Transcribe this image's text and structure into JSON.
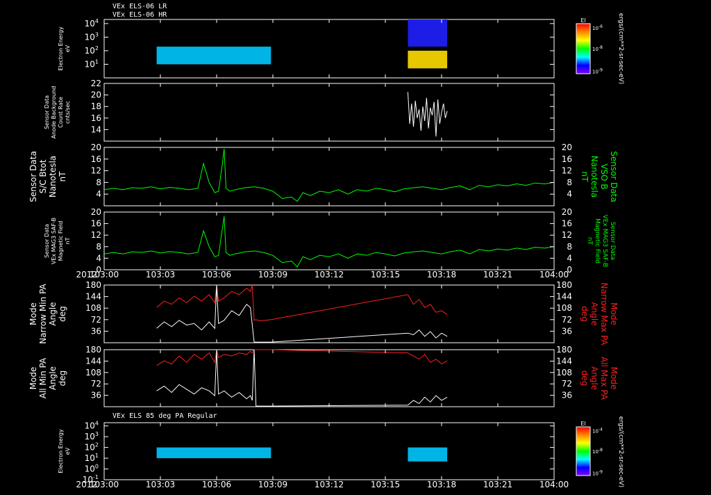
{
  "figure": {
    "header_lines": [
      "VEx ELS-06 LR",
      "VEx ELS-06 HR"
    ],
    "colorbar_unit": "ergs/(cm**2-sr-sec-eV)",
    "colorbar_title": "El",
    "time_axis_year": "2012",
    "time_ticks": [
      "103:00",
      "103:03",
      "103:06",
      "103:09",
      "103:12",
      "103:15",
      "103:18",
      "103:21",
      "104:00"
    ]
  },
  "chart_data": [
    {
      "id": "p1",
      "type": "heatmap",
      "ylabel": [
        "Electron Energy",
        "eV"
      ],
      "yscale": "log",
      "ylim": [
        1,
        20000
      ],
      "ytick_bases": [
        "10",
        "10",
        "10",
        "10"
      ],
      "ytick_exps": [
        "1",
        "2",
        "3",
        "4"
      ],
      "ytick_values": [
        10,
        100,
        1000,
        10000
      ],
      "colorbar": {
        "tick_bases": [
          "10",
          "10",
          "10"
        ],
        "tick_exps": [
          "-6",
          "-8",
          "-9"
        ],
        "colors": [
          "#ff0000",
          "#ff8800",
          "#ffff00",
          "#00ff00",
          "#00ffff",
          "#0000ff",
          "#8000ff"
        ]
      },
      "blocks": [
        {
          "x0": 2.8,
          "x1": 8.9,
          "ylo": 10,
          "yhi": 200,
          "color": "#00c8ff"
        },
        {
          "x0": 16.2,
          "x1": 18.3,
          "ylo": 5,
          "yhi": 100,
          "color": "#ffdd00"
        },
        {
          "x0": 16.2,
          "x1": 18.3,
          "ylo": 200,
          "yhi": 20000,
          "color": "#2020ff"
        }
      ]
    },
    {
      "id": "p2",
      "type": "line",
      "ylabel": [
        "Sensor Data",
        "Anode Background",
        "Count Rate",
        "cnts/sec"
      ],
      "ylim": [
        12,
        22
      ],
      "ytick_labels": [
        "14",
        "16",
        "18",
        "20",
        "22"
      ],
      "ytick_values": [
        14,
        16,
        18,
        20,
        22
      ],
      "series": [
        {
          "color": "#ffffff",
          "x": [
            16.2,
            16.3,
            16.4,
            16.5,
            16.6,
            16.7,
            16.8,
            16.9,
            17.0,
            17.1,
            17.2,
            17.3,
            17.4,
            17.5,
            17.6,
            17.7,
            17.8,
            17.9,
            18.0,
            18.1,
            18.2,
            18.3
          ],
          "y": [
            20.5,
            15.0,
            18.5,
            14.5,
            19.0,
            16.0,
            17.5,
            13.8,
            18.0,
            15.5,
            19.5,
            14.2,
            17.8,
            16.5,
            18.8,
            12.8,
            19.2,
            15.0,
            17.0,
            18.5,
            16.0,
            17.2
          ]
        }
      ]
    },
    {
      "id": "p3",
      "type": "line",
      "ylabel": [
        "Sensor Data",
        "S/C Btot",
        "Nanotesla",
        "nT"
      ],
      "ylabel_right": [
        "Sensor Data",
        "VSO B",
        "Nanotesla",
        "nT"
      ],
      "ylim": [
        0,
        20
      ],
      "ytick_labels": [
        "4",
        "8",
        "12",
        "16",
        "20"
      ],
      "ytick_values": [
        4,
        8,
        12,
        16,
        20
      ],
      "series": [
        {
          "color": "#00ff00",
          "x": [
            0.0,
            0.5,
            1.0,
            1.5,
            2.0,
            2.5,
            3.0,
            3.5,
            4.0,
            4.5,
            5.0,
            5.3,
            5.6,
            5.9,
            6.1,
            6.3,
            6.4,
            6.5,
            6.7,
            7.0,
            7.5,
            8.0,
            8.5,
            9.0,
            9.5,
            10.0,
            10.3,
            10.6,
            11.0,
            11.5,
            12.0,
            12.5,
            13.0,
            13.5,
            14.0,
            14.5,
            15.0,
            15.5,
            16.0,
            16.5,
            17.0,
            17.5,
            18.0,
            18.5,
            19.0,
            19.5,
            20.0,
            20.5,
            21.0,
            21.5,
            22.0,
            22.5,
            23.0,
            23.5,
            24.0
          ],
          "y": [
            5.5,
            6.0,
            5.5,
            6.2,
            6.0,
            6.5,
            5.8,
            6.3,
            6.0,
            5.5,
            6.0,
            14.5,
            8.0,
            4.5,
            5.0,
            14.0,
            19.5,
            6.0,
            5.0,
            5.5,
            6.2,
            6.5,
            6.0,
            5.0,
            2.5,
            3.0,
            1.5,
            4.5,
            3.5,
            5.0,
            4.5,
            5.5,
            4.0,
            5.5,
            5.0,
            6.0,
            5.5,
            4.8,
            5.8,
            6.2,
            6.5,
            6.0,
            5.5,
            6.3,
            6.8,
            5.5,
            7.0,
            6.5,
            7.2,
            6.8,
            7.5,
            7.0,
            7.8,
            7.5,
            8.0
          ]
        }
      ]
    },
    {
      "id": "p4",
      "type": "line",
      "ylabel": [
        "Sensor Data",
        "VEx MAG3 SAF-B",
        "Magnetic Field",
        "nT"
      ],
      "ylabel_right": [
        "Sensor Data",
        "VEx MAG3 SAF-B",
        "Magnetic Field",
        "nT"
      ],
      "ylim": [
        0,
        20
      ],
      "ytick_labels": [
        "0",
        "4",
        "8",
        "12",
        "16",
        "20"
      ],
      "ytick_values": [
        0,
        4,
        8,
        12,
        16,
        20
      ],
      "series": [
        {
          "color": "#00ff00",
          "x": [
            0.0,
            0.5,
            1.0,
            1.5,
            2.0,
            2.5,
            3.0,
            3.5,
            4.0,
            4.5,
            5.0,
            5.3,
            5.6,
            5.9,
            6.1,
            6.3,
            6.4,
            6.5,
            6.7,
            7.0,
            7.5,
            8.0,
            8.5,
            9.0,
            9.5,
            10.0,
            10.3,
            10.6,
            11.0,
            11.5,
            12.0,
            12.5,
            13.0,
            13.5,
            14.0,
            14.5,
            15.0,
            15.5,
            16.0,
            16.5,
            17.0,
            17.5,
            18.0,
            18.5,
            19.0,
            19.5,
            20.0,
            20.5,
            21.0,
            21.5,
            22.0,
            22.5,
            23.0,
            23.5,
            24.0
          ],
          "y": [
            5.5,
            6.0,
            5.5,
            6.2,
            6.0,
            6.5,
            5.8,
            6.3,
            6.0,
            5.5,
            6.0,
            13.5,
            8.0,
            4.5,
            5.0,
            14.0,
            18.5,
            6.0,
            5.0,
            5.5,
            6.2,
            6.5,
            6.0,
            5.0,
            2.5,
            3.0,
            1.0,
            4.5,
            3.5,
            5.0,
            4.5,
            5.5,
            4.0,
            5.5,
            5.0,
            6.0,
            5.5,
            4.8,
            5.8,
            6.2,
            6.5,
            6.0,
            5.5,
            6.3,
            6.8,
            5.5,
            7.0,
            6.5,
            7.2,
            6.8,
            7.5,
            7.0,
            7.8,
            7.5,
            8.0
          ]
        }
      ]
    },
    {
      "id": "p5",
      "type": "line",
      "ylabel": [
        "Mode",
        "Narrow Min PA",
        "Angle",
        "deg"
      ],
      "ylabel_right": [
        "Mode",
        "Narrow Max PA",
        "Angle",
        "deg"
      ],
      "ylim": [
        0,
        180
      ],
      "ytick_labels": [
        "36",
        "72",
        "108",
        "144",
        "180"
      ],
      "ytick_values": [
        36,
        72,
        108,
        144,
        180
      ],
      "series": [
        {
          "color": "#ff2020",
          "x": [
            2.8,
            3.2,
            3.6,
            4.0,
            4.4,
            4.8,
            5.2,
            5.6,
            5.9,
            6.0,
            6.1,
            6.4,
            6.8,
            7.2,
            7.6,
            7.8,
            7.9,
            8.0,
            8.1,
            8.3,
            8.9,
            16.2,
            16.5,
            16.8,
            17.1,
            17.4,
            17.7,
            18.0,
            18.3
          ],
          "y": [
            110,
            130,
            120,
            140,
            125,
            145,
            130,
            150,
            125,
            180,
            130,
            140,
            160,
            150,
            170,
            160,
            180,
            70,
            72,
            68,
            72,
            150,
            120,
            135,
            110,
            120,
            95,
            100,
            88
          ]
        },
        {
          "color": "#ffffff",
          "x": [
            2.8,
            3.2,
            3.6,
            4.0,
            4.4,
            4.8,
            5.2,
            5.6,
            5.9,
            6.0,
            6.1,
            6.4,
            6.8,
            7.2,
            7.6,
            7.8,
            8.0,
            8.1,
            8.9,
            16.2,
            16.5,
            16.8,
            17.1,
            17.4,
            17.7,
            18.0,
            18.3
          ],
          "y": [
            45,
            65,
            50,
            70,
            55,
            60,
            40,
            65,
            45,
            180,
            60,
            70,
            100,
            85,
            120,
            110,
            2,
            2,
            2,
            30,
            25,
            40,
            20,
            35,
            15,
            30,
            20
          ]
        }
      ]
    },
    {
      "id": "p6",
      "type": "line",
      "ylabel": [
        "Mode",
        "All Min PA",
        "Angle",
        "deg"
      ],
      "ylabel_right": [
        "Mode",
        "All Max PA",
        "Angle",
        "deg"
      ],
      "ylim": [
        0,
        180
      ],
      "ytick_labels": [
        "36",
        "72",
        "108",
        "144",
        "180"
      ],
      "ytick_values": [
        36,
        72,
        108,
        144,
        180
      ],
      "series": [
        {
          "color": "#ff2020",
          "x": [
            2.8,
            3.2,
            3.6,
            4.0,
            4.4,
            4.8,
            5.2,
            5.6,
            5.9,
            6.0,
            6.1,
            6.4,
            6.8,
            7.2,
            7.6,
            7.8,
            7.9,
            8.0,
            8.9,
            16.2,
            16.5,
            16.8,
            17.1,
            17.4,
            17.7,
            18.0,
            18.3
          ],
          "y": [
            130,
            145,
            135,
            160,
            140,
            165,
            150,
            170,
            140,
            180,
            155,
            165,
            160,
            170,
            165,
            175,
            170,
            180,
            180,
            170,
            160,
            150,
            165,
            140,
            150,
            135,
            145
          ]
        },
        {
          "color": "#ffffff",
          "x": [
            2.8,
            3.2,
            3.6,
            4.0,
            4.4,
            4.8,
            5.2,
            5.6,
            5.9,
            6.0,
            6.1,
            6.4,
            6.8,
            7.2,
            7.6,
            7.8,
            7.9,
            8.0,
            8.1,
            8.9,
            16.2,
            16.5,
            16.8,
            17.1,
            17.4,
            17.7,
            18.0,
            18.3
          ],
          "y": [
            50,
            65,
            45,
            70,
            55,
            40,
            60,
            50,
            35,
            180,
            40,
            50,
            30,
            45,
            25,
            35,
            20,
            180,
            2,
            2,
            5,
            20,
            10,
            30,
            15,
            35,
            20,
            30
          ]
        }
      ]
    },
    {
      "id": "p7",
      "type": "heatmap",
      "title": "VEx ELS 85 deg PA Regular",
      "ylabel": [
        "Electron Energy",
        "eV"
      ],
      "yscale": "log",
      "ylim": [
        0.1,
        20000
      ],
      "ytick_bases": [
        "10",
        "10",
        "10",
        "10",
        "10",
        "10"
      ],
      "ytick_exps": [
        "-1",
        "0",
        "1",
        "2",
        "3",
        "4"
      ],
      "ytick_values": [
        0.1,
        1,
        10,
        100,
        1000,
        10000
      ],
      "colorbar": {
        "tick_bases": [
          "10",
          "10",
          "10"
        ],
        "tick_exps": [
          "-4",
          "-8",
          "-9"
        ],
        "colors": [
          "#ff0000",
          "#ff8800",
          "#ffff00",
          "#00ff00",
          "#00ffff",
          "#0000ff",
          "#8000ff"
        ]
      },
      "blocks": [
        {
          "x0": 2.8,
          "x1": 8.9,
          "ylo": 10,
          "yhi": 100,
          "color": "#00c8ff"
        },
        {
          "x0": 16.2,
          "x1": 18.3,
          "ylo": 5,
          "yhi": 100,
          "color": "#00c8ff"
        }
      ]
    }
  ]
}
